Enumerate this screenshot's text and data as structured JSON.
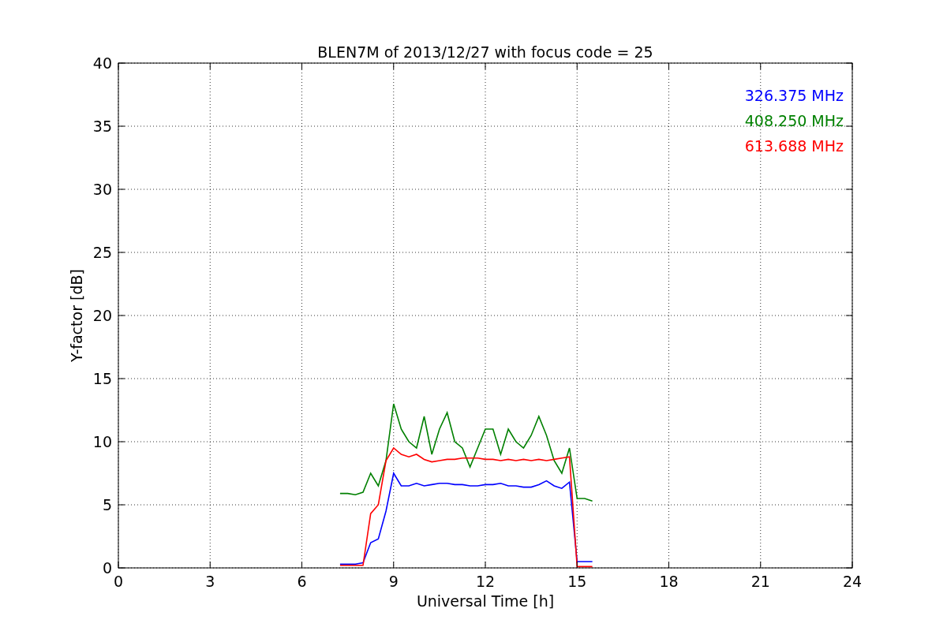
{
  "chart": {
    "chart_data": {
      "type": "line",
      "title": "BLEN7M of 2013/12/27 with focus code = 25",
      "xlabel": "Universal Time [h]",
      "ylabel": "Y-factor [dB]",
      "x": [
        7.25,
        7.5,
        7.75,
        8,
        8.25,
        8.5,
        8.75,
        9,
        9.25,
        9.5,
        9.75,
        10,
        10.25,
        10.5,
        10.75,
        11,
        11.25,
        11.5,
        11.75,
        12,
        12.25,
        12.5,
        12.75,
        13,
        13.25,
        13.5,
        13.75,
        14,
        14.25,
        14.5,
        14.75,
        15,
        15.25,
        15.5
      ],
      "series": [
        {
          "name": "326.375 MHz",
          "color": "#0000ff",
          "values": [
            0.3,
            0.3,
            0.3,
            0.4,
            2,
            2.3,
            4.5,
            7.5,
            6.5,
            6.5,
            6.7,
            6.5,
            6.6,
            6.7,
            6.7,
            6.6,
            6.6,
            6.5,
            6.5,
            6.6,
            6.6,
            6.7,
            6.5,
            6.5,
            6.4,
            6.4,
            6.6,
            6.9,
            6.5,
            6.3,
            6.8,
            0.5,
            0.5,
            0.5
          ]
        },
        {
          "name": "408.250 MHz",
          "color": "#008000",
          "values": [
            5.9,
            5.9,
            5.8,
            6,
            7.5,
            6.5,
            8.5,
            13,
            11,
            10,
            9.5,
            12,
            9,
            11,
            12.3,
            10,
            9.5,
            8,
            9.5,
            11,
            11,
            9,
            11,
            10,
            9.5,
            10.5,
            12,
            10.5,
            8.5,
            7.5,
            9.5,
            5.5,
            5.5,
            5.3
          ]
        },
        {
          "name": "613.688 MHz",
          "color": "#ff0000",
          "values": [
            0.2,
            0.2,
            0.2,
            0.2,
            4.3,
            5,
            8.5,
            9.5,
            9,
            8.8,
            9,
            8.6,
            8.4,
            8.5,
            8.6,
            8.6,
            8.7,
            8.7,
            8.7,
            8.6,
            8.6,
            8.5,
            8.6,
            8.5,
            8.6,
            8.5,
            8.6,
            8.5,
            8.6,
            8.7,
            8.8,
            0.1,
            0.1,
            0.1
          ]
        }
      ],
      "xlim": [
        0,
        24
      ],
      "ylim": [
        0,
        40
      ],
      "xticks": [
        0,
        3,
        6,
        9,
        12,
        15,
        18,
        21,
        24
      ],
      "yticks": [
        0,
        5,
        10,
        15,
        20,
        25,
        30,
        35,
        40
      ],
      "grid": true
    }
  }
}
